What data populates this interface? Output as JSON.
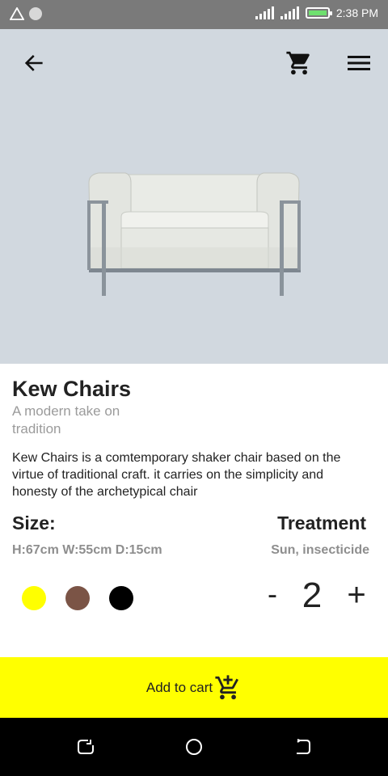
{
  "status_bar": {
    "time": "2:38 PM"
  },
  "header": {
    "icons": [
      "arrow-back-icon",
      "shopping-cart-icon",
      "hamburger-menu-icon"
    ]
  },
  "product": {
    "name": "Kew Chairs",
    "subtitle": "A modern take on tradition",
    "description": "Kew Chairs is a comtemporary shaker chair based on the virtue of traditional craft. it carries on the simplicity and honesty of the archetypical chair",
    "size_label": "Size:",
    "size_value": "H:67cm W:55cm D:15cm",
    "treatment_label": "Treatment",
    "treatment_value": "Sun, insecticide",
    "colors": [
      "#ffff00",
      "#7b5446",
      "#000000"
    ]
  },
  "quantity": {
    "minus_label": "-",
    "value": "2",
    "plus_label": "+"
  },
  "cart_button": {
    "label": "Add to cart"
  },
  "theme": {
    "accent": "#ffff00",
    "hero_background": "#d1d8df"
  }
}
